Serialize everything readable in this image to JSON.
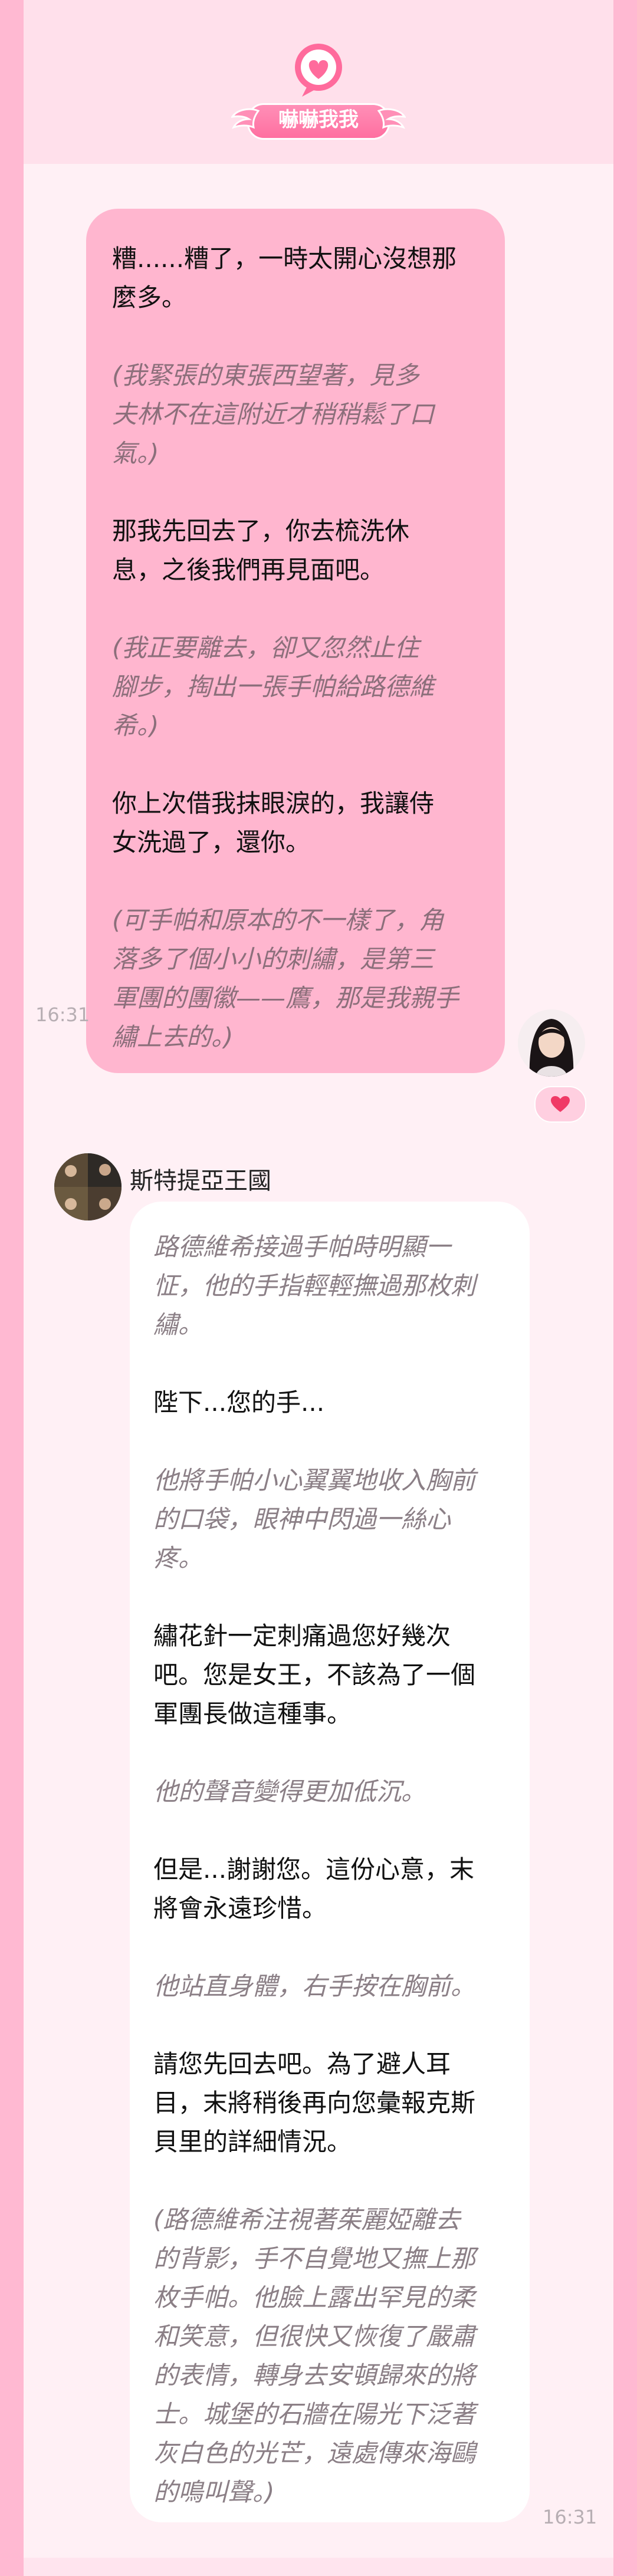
{
  "app": {
    "title": "嚇嚇我我"
  },
  "messages": [
    {
      "side": "right",
      "time": "16:31",
      "lines": [
        {
          "style": "normal",
          "text": "糟......糟了，一時太開心沒想那"
        },
        {
          "style": "normal",
          "text": "麼多。"
        },
        {
          "style": "gap",
          "text": ""
        },
        {
          "style": "italic",
          "text": "(我緊張的東張西望著，見多"
        },
        {
          "style": "italic",
          "text": "夫林不在這附近才稍稍鬆了口"
        },
        {
          "style": "italic",
          "text": "氣。)"
        },
        {
          "style": "gap",
          "text": ""
        },
        {
          "style": "normal",
          "text": "那我先回去了，你去梳洗休"
        },
        {
          "style": "normal",
          "text": "息，之後我們再見面吧。"
        },
        {
          "style": "gap",
          "text": ""
        },
        {
          "style": "italic",
          "text": "(我正要離去，卻又忽然止住"
        },
        {
          "style": "italic",
          "text": "腳步，掏出一張手帕給路德維"
        },
        {
          "style": "italic",
          "text": "希。)"
        },
        {
          "style": "gap",
          "text": ""
        },
        {
          "style": "normal",
          "text": "你上次借我抹眼淚的，我讓侍"
        },
        {
          "style": "normal",
          "text": "女洗過了，還你。"
        },
        {
          "style": "gap",
          "text": ""
        },
        {
          "style": "italic",
          "text": "(可手帕和原本的不一樣了，角"
        },
        {
          "style": "italic",
          "text": "落多了個小小的刺繡，是第三"
        },
        {
          "style": "italic",
          "text": "軍團的團徽——鷹，那是我親手"
        },
        {
          "style": "italic",
          "text": "繡上去的。)"
        }
      ]
    },
    {
      "side": "left",
      "sender": "斯特提亞王國",
      "time": "16:31",
      "lines": [
        {
          "style": "italic",
          "text": "路德維希接過手帕時明顯一"
        },
        {
          "style": "italic",
          "text": "怔，他的手指輕輕撫過那枚刺"
        },
        {
          "style": "italic",
          "text": "繡。"
        },
        {
          "style": "gap",
          "text": ""
        },
        {
          "style": "normal",
          "text": "陛下...您的手..."
        },
        {
          "style": "gap",
          "text": ""
        },
        {
          "style": "italic",
          "text": "他將手帕小心翼翼地收入胸前"
        },
        {
          "style": "italic",
          "text": "的口袋，眼神中閃過一絲心"
        },
        {
          "style": "italic",
          "text": "疼。"
        },
        {
          "style": "gap",
          "text": ""
        },
        {
          "style": "normal",
          "text": "繡花針一定刺痛過您好幾次"
        },
        {
          "style": "normal",
          "text": "吧。您是女王，不該為了一個"
        },
        {
          "style": "normal",
          "text": "軍團長做這種事。"
        },
        {
          "style": "gap",
          "text": ""
        },
        {
          "style": "italic",
          "text": "他的聲音變得更加低沉。"
        },
        {
          "style": "gap",
          "text": ""
        },
        {
          "style": "normal",
          "text": "但是...謝謝您。這份心意，末"
        },
        {
          "style": "normal",
          "text": "將會永遠珍惜。"
        },
        {
          "style": "gap",
          "text": ""
        },
        {
          "style": "italic",
          "text": "他站直身體，右手按在胸前。"
        },
        {
          "style": "gap",
          "text": ""
        },
        {
          "style": "normal",
          "text": "請您先回去吧。為了避人耳"
        },
        {
          "style": "normal",
          "text": "目，末將稍後再向您彙報克斯"
        },
        {
          "style": "normal",
          "text": "貝里的詳細情況。"
        },
        {
          "style": "gap",
          "text": ""
        },
        {
          "style": "italic",
          "text": "(路德維希注視著茱麗婭離去"
        },
        {
          "style": "italic",
          "text": "的背影，手不自覺地又撫上那"
        },
        {
          "style": "italic",
          "text": "枚手帕。他臉上露出罕見的柔"
        },
        {
          "style": "italic",
          "text": "和笑意，但很快又恢復了嚴肅"
        },
        {
          "style": "italic",
          "text": "的表情，轉身去安頓歸來的將"
        },
        {
          "style": "italic",
          "text": "士。城堡的石牆在陽光下泛著"
        },
        {
          "style": "italic",
          "text": "灰白色的光芒，遠處傳來海鷗"
        },
        {
          "style": "italic",
          "text": "的鳴叫聲。)"
        }
      ]
    }
  ],
  "icons": {
    "logo": "chat-heart-logo-icon",
    "reaction": "heart-icon"
  },
  "colors": {
    "outer": "#ffb9d2",
    "panel": "#fff0f5",
    "right_bubble": "#ffb6cf",
    "left_bubble": "#ffffff",
    "accent": "#ff5c8e",
    "italic_text": "#8b7f86"
  }
}
